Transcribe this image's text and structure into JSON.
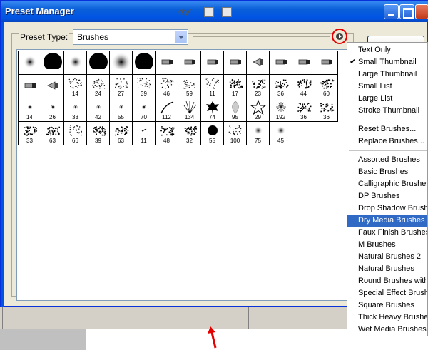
{
  "window": {
    "title": "Preset Manager"
  },
  "preset_type": {
    "label": "Preset Type:",
    "value": "Brushes"
  },
  "brushes": {
    "rows": [
      [
        {
          "n": "",
          "kind": "soft",
          "s": 7
        },
        {
          "n": "",
          "kind": "hard",
          "s": 13
        },
        {
          "n": "",
          "kind": "soft",
          "s": 7
        },
        {
          "n": "",
          "kind": "hard",
          "s": 13
        },
        {
          "n": "",
          "kind": "soft",
          "s": 12
        },
        {
          "n": "",
          "kind": "hard",
          "s": 13
        },
        {
          "n": "",
          "kind": "tool"
        },
        {
          "n": "",
          "kind": "tool"
        },
        {
          "n": "",
          "kind": "tool"
        },
        {
          "n": "",
          "kind": "tool"
        },
        {
          "n": "",
          "kind": "cone"
        },
        {
          "n": "",
          "kind": "tool"
        },
        {
          "n": "",
          "kind": "tool"
        },
        {
          "n": "",
          "kind": "tool"
        }
      ],
      [
        {
          "n": "",
          "kind": "tool"
        },
        {
          "n": "",
          "kind": "cone"
        },
        {
          "n": "14",
          "kind": "speck"
        },
        {
          "n": "24",
          "kind": "speck"
        },
        {
          "n": "27",
          "kind": "speck"
        },
        {
          "n": "39",
          "kind": "speck"
        },
        {
          "n": "46",
          "kind": "speck"
        },
        {
          "n": "59",
          "kind": "speck"
        },
        {
          "n": "11",
          "kind": "speck"
        },
        {
          "n": "17",
          "kind": "blob"
        },
        {
          "n": "23",
          "kind": "blob"
        },
        {
          "n": "36",
          "kind": "blob"
        },
        {
          "n": "44",
          "kind": "blob"
        },
        {
          "n": "60",
          "kind": "blob"
        }
      ],
      [
        {
          "n": "14",
          "kind": "star"
        },
        {
          "n": "26",
          "kind": "star"
        },
        {
          "n": "33",
          "kind": "star"
        },
        {
          "n": "42",
          "kind": "star"
        },
        {
          "n": "55",
          "kind": "star"
        },
        {
          "n": "70",
          "kind": "star"
        },
        {
          "n": "112",
          "kind": "stroke"
        },
        {
          "n": "134",
          "kind": "grass"
        },
        {
          "n": "74",
          "kind": "leaf"
        },
        {
          "n": "95",
          "kind": "leaf2"
        },
        {
          "n": "29",
          "kind": "starshape"
        },
        {
          "n": "192",
          "kind": "burst"
        },
        {
          "n": "36",
          "kind": "blob"
        },
        {
          "n": "36",
          "kind": "blob"
        }
      ],
      [
        {
          "n": "33",
          "kind": "blob"
        },
        {
          "n": "63",
          "kind": "blob"
        },
        {
          "n": "66",
          "kind": "speck"
        },
        {
          "n": "39",
          "kind": "blob"
        },
        {
          "n": "63",
          "kind": "blob"
        },
        {
          "n": "11",
          "kind": "dash"
        },
        {
          "n": "48",
          "kind": "blob"
        },
        {
          "n": "32",
          "kind": "blob"
        },
        {
          "n": "55",
          "kind": "hardsm"
        },
        {
          "n": "100",
          "kind": "speck"
        },
        {
          "n": "75",
          "kind": "soft",
          "s": 4
        },
        {
          "n": "45",
          "kind": "soft",
          "s": 4
        }
      ]
    ]
  },
  "menu": {
    "view_items": [
      {
        "label": "Text Only",
        "checked": false
      },
      {
        "label": "Small Thumbnail",
        "checked": true
      },
      {
        "label": "Large Thumbnail",
        "checked": false
      },
      {
        "label": "Small List",
        "checked": false
      },
      {
        "label": "Large List",
        "checked": false
      },
      {
        "label": "Stroke Thumbnail",
        "checked": false
      }
    ],
    "actions": [
      {
        "label": "Reset Brushes..."
      },
      {
        "label": "Replace Brushes..."
      }
    ],
    "libraries": [
      {
        "label": "Assorted Brushes",
        "selected": false
      },
      {
        "label": "Basic Brushes",
        "selected": false
      },
      {
        "label": "Calligraphic Brushes",
        "selected": false
      },
      {
        "label": "DP Brushes",
        "selected": false
      },
      {
        "label": "Drop Shadow Brushes",
        "selected": false
      },
      {
        "label": "Dry Media Brushes",
        "selected": true
      },
      {
        "label": "Faux Finish Brushes",
        "selected": false
      },
      {
        "label": "M Brushes",
        "selected": false
      },
      {
        "label": "Natural Brushes 2",
        "selected": false
      },
      {
        "label": "Natural Brushes",
        "selected": false
      },
      {
        "label": "Round Brushes with Size",
        "selected": false
      },
      {
        "label": "Special Effect Brushes",
        "selected": false
      },
      {
        "label": "Square Brushes",
        "selected": false
      },
      {
        "label": "Thick Heavy Brushes",
        "selected": false
      },
      {
        "label": "Wet Media Brushes",
        "selected": false
      }
    ]
  },
  "colors": {
    "titlebar": "#0054e3",
    "menu_selected": "#316ac5",
    "highlight_circle": "#e40000",
    "annotation_arrow": "#e40000"
  }
}
